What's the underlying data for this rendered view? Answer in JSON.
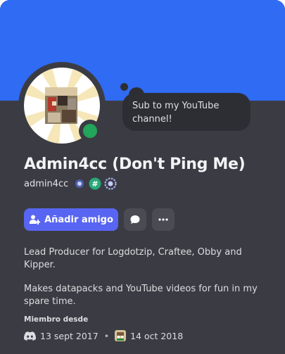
{
  "colors": {
    "banner": "#2f6bf3",
    "card_bg": "#3b3c43",
    "status_online": "#23a55a",
    "accent_button": "#5865f2"
  },
  "profile": {
    "status_bubble": "Sub to my YouTube channel!",
    "display_name": "Admin4cc (Don't Ping Me)",
    "username": "admin4cc",
    "badges": [
      "nitro-boost-badge-icon",
      "hashtag-badge-icon",
      "quest-laurel-badge-icon"
    ],
    "status": "online"
  },
  "actions": {
    "add_friend_label": "Añadir amigo",
    "message_icon": "message-bubble-icon",
    "more_icon": "more-dots-icon"
  },
  "bio": {
    "line1": "Lead Producer for Logdotzip, Craftee, Obby and Kipper.",
    "line2": "Makes datapacks and YouTube videos for fun in my spare time."
  },
  "member_since": {
    "title": "Miembro desde",
    "discord_date": "13 sept 2017",
    "separator": "•",
    "server_date": "14 oct 2018",
    "discord_icon": "discord-logo-icon",
    "server_icon": "server-avatar-icon"
  }
}
